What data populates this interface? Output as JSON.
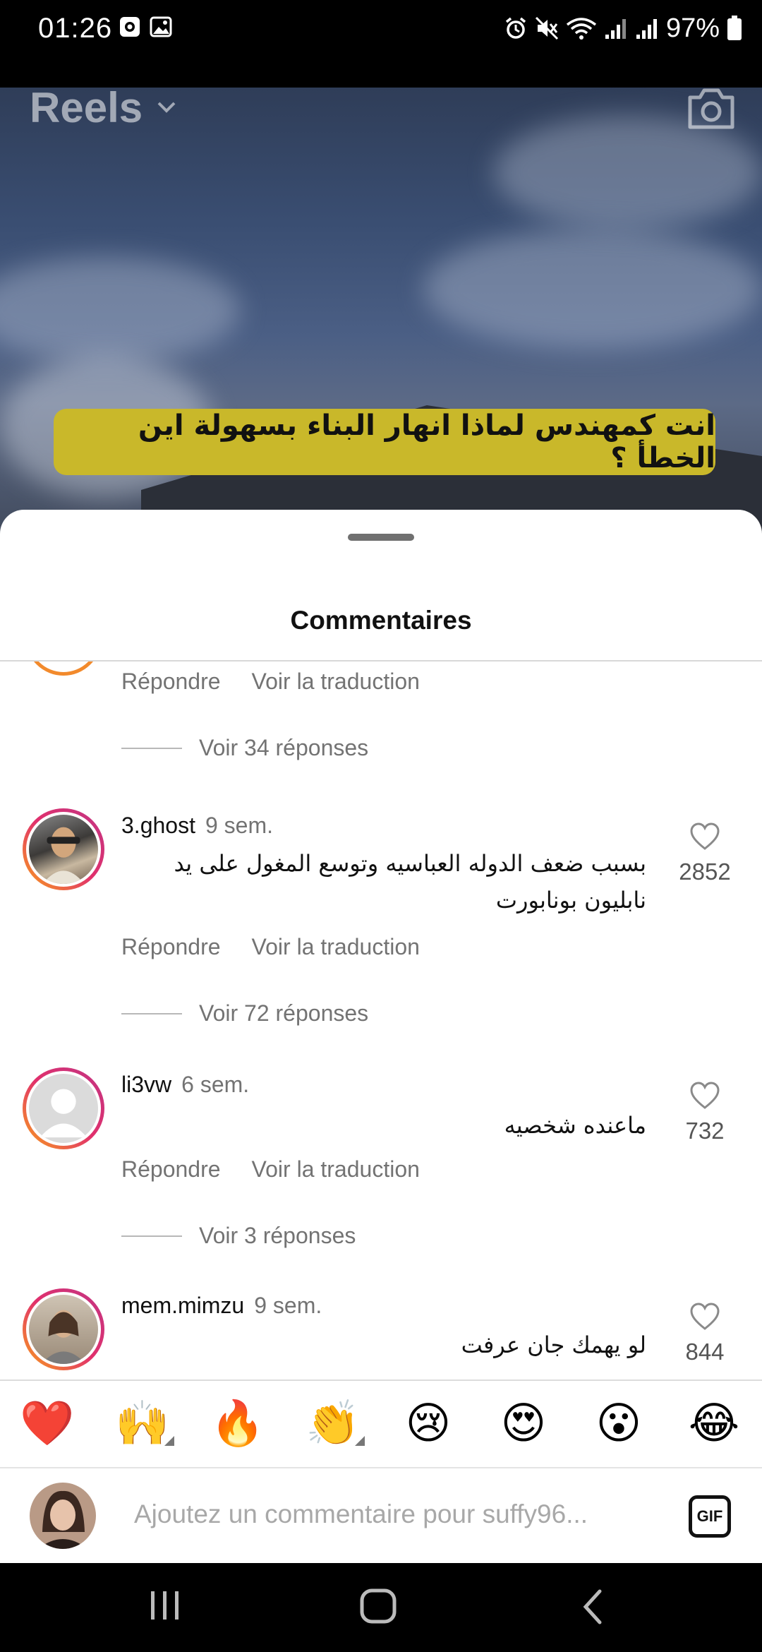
{
  "status_bar": {
    "time": "01:26",
    "battery": "97%"
  },
  "reel": {
    "title": "Reels",
    "banner_text": "انت كمهندس لماذا انهار البناء بسهولة اين الخطأ ؟"
  },
  "sheet": {
    "title": "Commentaires",
    "top_actions": {
      "reply": "Répondre",
      "translate": "Voir la traduction"
    },
    "top_replies": "Voir 34 réponses",
    "comments": [
      {
        "username": "3.ghost",
        "time": "9 sem.",
        "text": "بسبب ضعف الدوله العباسيه وتوسع المغول على يد نابليون بونابورت",
        "likes": "2852",
        "reply": "Répondre",
        "translate": "Voir la traduction",
        "replies": "Voir 72 réponses"
      },
      {
        "username": "li3vw",
        "time": "6 sem.",
        "text": "ماعنده شخصيه",
        "likes": "732",
        "reply": "Répondre",
        "translate": "Voir la traduction",
        "replies": "Voir 3 réponses"
      },
      {
        "username": "mem.mimzu",
        "time": "9 sem.",
        "text": "لو يهمك جان عرفت",
        "likes": "844"
      }
    ]
  },
  "emoji_bar": [
    "❤️",
    "🙌",
    "🔥",
    "👏",
    "😢",
    "😍",
    "😮",
    "😂"
  ],
  "composer": {
    "placeholder": "Ajoutez un commentaire pour suffy96...",
    "gif_label": "GIF"
  },
  "colors": {
    "accent_ring_start": "#f9a11b",
    "accent_ring_end": "#c13584",
    "banner": "#c9b82a",
    "heart": "#e0102a"
  }
}
